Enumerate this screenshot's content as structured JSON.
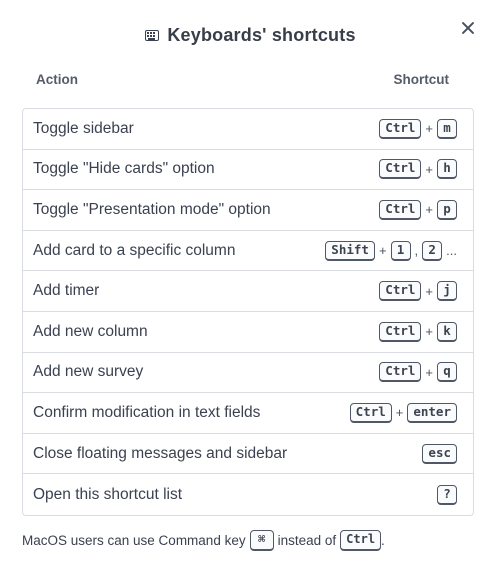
{
  "dialog": {
    "title": "Keyboards' shortcuts",
    "title_icon": "keyboard-icon",
    "close_icon": "close-icon"
  },
  "columns": {
    "action": "Action",
    "shortcut": "Shortcut"
  },
  "shortcuts": [
    {
      "label": "Toggle sidebar",
      "k1": "Ctrl",
      "sep": "+",
      "k2": "m"
    },
    {
      "label": "Toggle \"Hide cards\" option",
      "k1": "Ctrl",
      "sep": "+",
      "k2": "h"
    },
    {
      "label": "Toggle \"Presentation mode\" option",
      "k1": "Ctrl",
      "sep": "+",
      "k2": "p"
    },
    {
      "label": "Add card to a specific column",
      "k1": "Shift",
      "sep": "+",
      "k2": "1",
      "sep2": ",",
      "k3": "2",
      "tail": "..."
    },
    {
      "label": "Add timer",
      "k1": "Ctrl",
      "sep": "+",
      "k2": "j"
    },
    {
      "label": "Add new column",
      "k1": "Ctrl",
      "sep": "+",
      "k2": "k"
    },
    {
      "label": "Add new survey",
      "k1": "Ctrl",
      "sep": "+",
      "k2": "q"
    },
    {
      "label": "Confirm modification in text fields",
      "k1": "Ctrl",
      "sep": "+",
      "k2": "enter"
    },
    {
      "label": "Close floating messages and sidebar",
      "k1": "esc"
    },
    {
      "label": "Open this shortcut list",
      "k1": "?"
    }
  ],
  "footer": {
    "before": "MacOS users can use Command key",
    "cmd_key": "⌘",
    "middle": "instead of",
    "ctrl_key": "Ctrl",
    "after": "."
  }
}
